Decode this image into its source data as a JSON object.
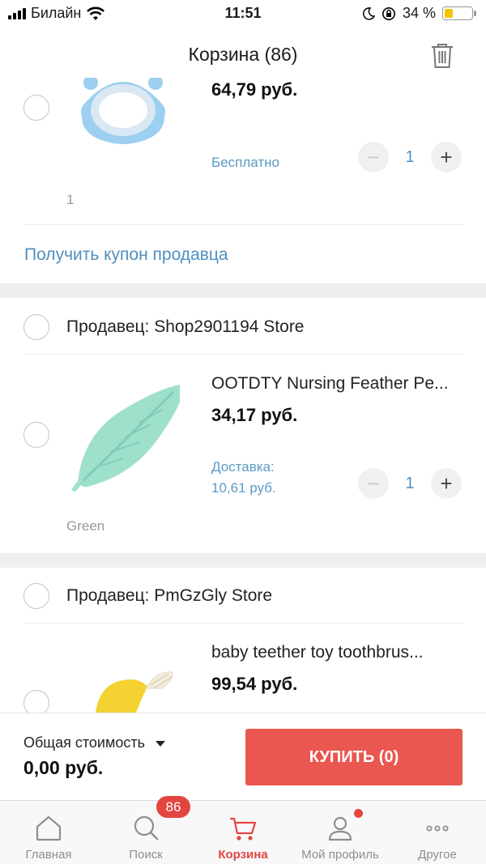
{
  "status_bar": {
    "carrier": "Билайн",
    "time": "11:51",
    "battery": "34 %",
    "battery_level": 0.34
  },
  "header": {
    "title": "Корзина (86)"
  },
  "cart": {
    "item_top": {
      "price": "64,79 руб.",
      "shipping": "Бесплатно",
      "quantity": "1",
      "variant": "1"
    },
    "coupon_label": "Получить купон продавца",
    "store_1": {
      "seller": "Продавец: Shop2901194 Store",
      "item": {
        "title": "OOTDTY Nursing Feather Pe...",
        "price": "34,17 руб.",
        "shipping_label": "Доставка:",
        "shipping_cost": "10,61 руб.",
        "quantity": "1",
        "variant": "Green"
      }
    },
    "store_2": {
      "seller": "Продавец: PmGzGly Store",
      "item": {
        "title": "baby teether toy toothbrus...",
        "price": "99,54 руб."
      }
    }
  },
  "summary": {
    "total_label": "Общая стоимость",
    "total_value": "0,00 руб.",
    "buy_label": "КУПИТЬ (0)"
  },
  "tabbar": {
    "tabs": [
      {
        "label": "Главная",
        "icon": "home-icon"
      },
      {
        "label": "Поиск",
        "icon": "search-icon"
      },
      {
        "label": "Корзина",
        "icon": "cart-icon",
        "active": true,
        "badge": "86"
      },
      {
        "label": "Мой профиль",
        "icon": "profile-icon"
      },
      {
        "label": "Другое",
        "icon": "more-icon"
      }
    ]
  },
  "colors": {
    "accent_red": "#ea5650",
    "link_blue": "#4f8fbf",
    "battery_yellow": "#f5c400"
  }
}
